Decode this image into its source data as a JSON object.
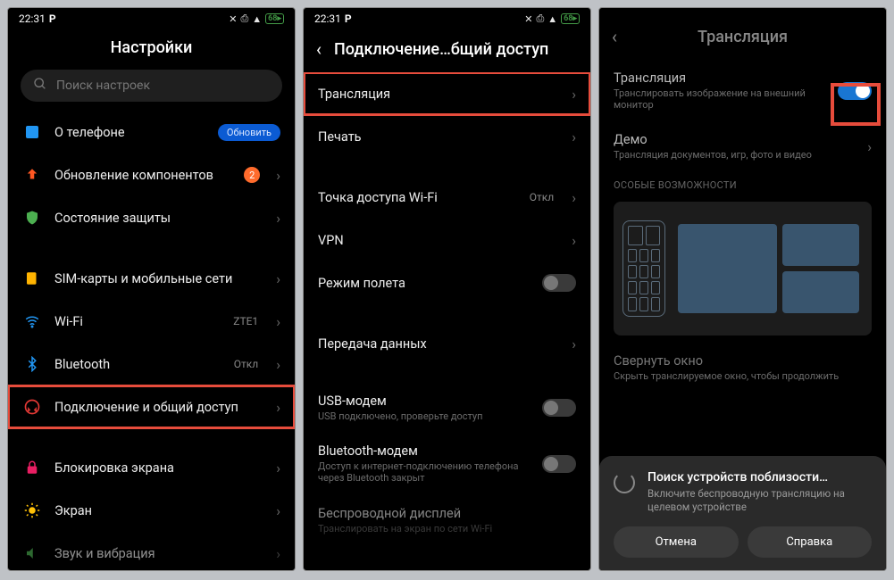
{
  "statusbar": {
    "time": "22:31",
    "battery": "68"
  },
  "screen1": {
    "title": "Настройки",
    "search_placeholder": "Поиск настроек",
    "items": {
      "about": "О телефоне",
      "update_badge": "Обновить",
      "components": "Обновление компонентов",
      "components_badge": "2",
      "security": "Состояние защиты",
      "sim": "SIM-карты и мобильные сети",
      "wifi": "Wi-Fi",
      "wifi_value": "ZTE1",
      "bluetooth": "Bluetooth",
      "bluetooth_value": "Откл",
      "connection": "Подключение и общий доступ",
      "lockscreen": "Блокировка экрана",
      "display": "Экран",
      "sound": "Звук и вибрация"
    }
  },
  "screen2": {
    "title": "Подключение…бщий доступ",
    "items": {
      "cast": "Трансляция",
      "print": "Печать",
      "hotspot": "Точка доступа Wi-Fi",
      "hotspot_value": "Откл",
      "vpn": "VPN",
      "airplane": "Режим полета",
      "data": "Передача данных",
      "usb": "USB-модем",
      "usb_sub": "USB подключено, проверьте доступ",
      "bt": "Bluetooth-модем",
      "bt_sub": "Доступ к интернет-подключению телефона через Bluetooth закрыт",
      "wdisplay": "Беспроводной дисплей",
      "wdisplay_sub": "Транслировать на экран по сети Wi-Fi"
    }
  },
  "screen3": {
    "title": "Трансляция",
    "cast": "Трансляция",
    "cast_sub": "Транслировать изображение на внешний монитор",
    "demo": "Демо",
    "demo_sub": "Трансляция документов, игр, фото и видео",
    "section": "ОСОБЫЕ ВОЗМОЖНОСТИ",
    "minimize": "Свернуть окно",
    "minimize_sub": "Скрыть транслируемое окно, чтобы продолжить",
    "sheet": {
      "title": "Поиск устройств поблизости…",
      "sub": "Включите беспроводную трансляцию на целевом устройстве",
      "cancel": "Отмена",
      "help": "Справка"
    }
  }
}
